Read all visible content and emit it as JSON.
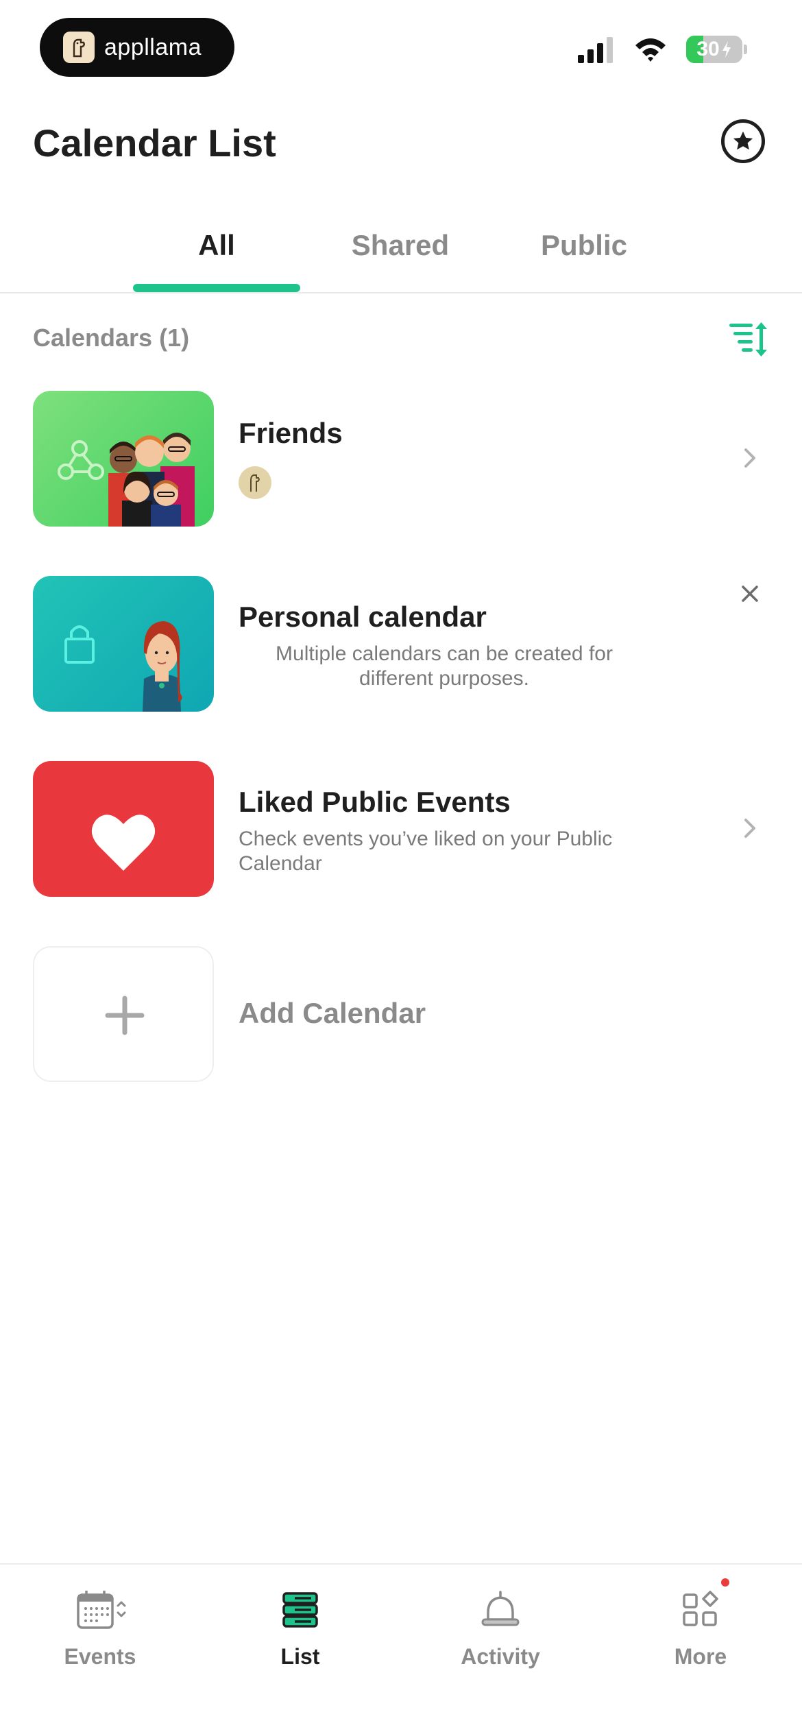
{
  "status_bar": {
    "recorder_label": "appllama",
    "battery_level": "30",
    "battery_fraction": 0.3
  },
  "header": {
    "title": "Calendar List"
  },
  "tabs": [
    {
      "label": "All",
      "active": true
    },
    {
      "label": "Shared",
      "active": false
    },
    {
      "label": "Public",
      "active": false
    }
  ],
  "section": {
    "label": "Calendars (1)"
  },
  "calendars": [
    {
      "title": "Friends",
      "description": ""
    },
    {
      "title": "Personal calendar",
      "description": "Multiple calendars can be created for different purposes."
    },
    {
      "title": "Liked Public Events",
      "description": "Check events you’ve liked on your Public Calendar"
    }
  ],
  "add_calendar": {
    "label": "Add Calendar"
  },
  "bottom_nav": [
    {
      "label": "Events",
      "icon": "calendar-grid-icon",
      "active": false
    },
    {
      "label": "List",
      "icon": "stacked-list-icon",
      "active": true
    },
    {
      "label": "Activity",
      "icon": "bell-icon",
      "active": false
    },
    {
      "label": "More",
      "icon": "apps-grid-icon",
      "active": false,
      "badge": true
    }
  ],
  "colors": {
    "accent": "#1ec38c",
    "text_primary": "#1f1f1f",
    "text_secondary": "#8a8a8a",
    "friends_tile": "#4fd46a",
    "personal_tile": "#17b5b5",
    "liked_tile": "#e8383d",
    "badge": "#ec3b3b"
  }
}
